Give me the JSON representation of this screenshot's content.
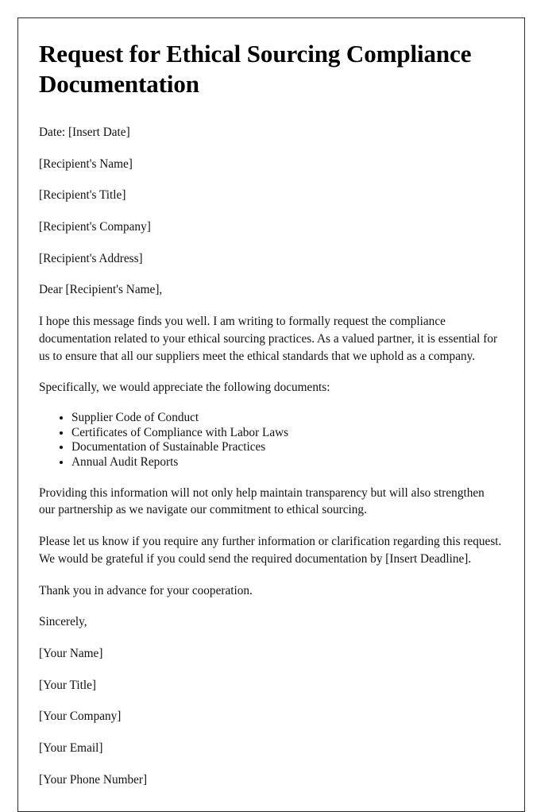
{
  "document": {
    "title": "Request for Ethical Sourcing Compliance Documentation",
    "date_line": "Date: [Insert Date]",
    "recipient": {
      "name": "[Recipient's Name]",
      "title": "[Recipient's Title]",
      "company": "[Recipient's Company]",
      "address": "[Recipient's Address]"
    },
    "salutation": "Dear [Recipient's Name],",
    "paragraph_intro": "I hope this message finds you well. I am writing to formally request the compliance documentation related to your ethical sourcing practices. As a valued partner, it is essential for us to ensure that all our suppliers meet the ethical standards that we uphold as a company.",
    "paragraph_request_lead": "Specifically, we would appreciate the following documents:",
    "requested_documents": [
      "Supplier Code of Conduct",
      "Certificates of Compliance with Labor Laws",
      "Documentation of Sustainable Practices",
      "Annual Audit Reports"
    ],
    "paragraph_transparency": "Providing this information will not only help maintain transparency but will also strengthen our partnership as we navigate our commitment to ethical sourcing.",
    "paragraph_closing_request": "Please let us know if you require any further information or clarification regarding this request. We would be grateful if you could send the required documentation by [Insert Deadline].",
    "paragraph_thanks": "Thank you in advance for your cooperation.",
    "closing": "Sincerely,",
    "sender": {
      "name": "[Your Name]",
      "title": "[Your Title]",
      "company": "[Your Company]",
      "email": "[Your Email]",
      "phone": "[Your Phone Number]"
    }
  }
}
